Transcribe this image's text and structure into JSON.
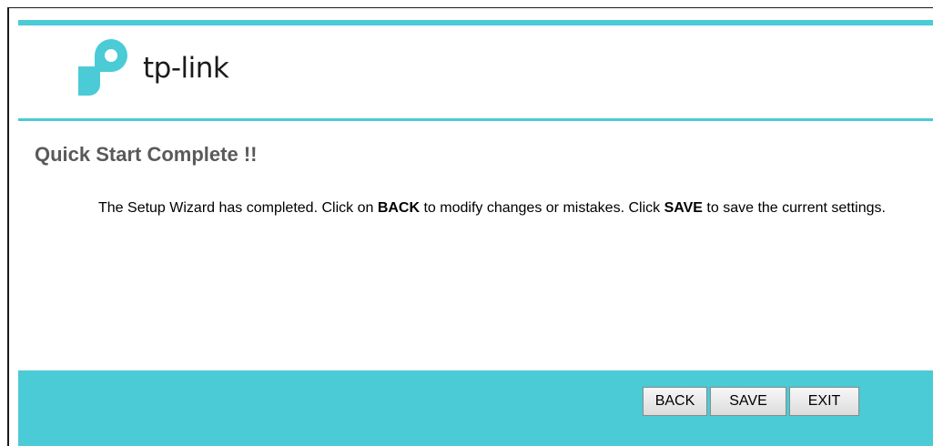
{
  "brand": {
    "logo_text": "tp-link",
    "logo_icon": "tp-link-logo-icon",
    "accent_color": "#4acbd6"
  },
  "page": {
    "title": "Quick Start Complete !!"
  },
  "message": {
    "part1": "The Setup Wizard has completed. Click on ",
    "back_word": "BACK",
    "part2": " to modify changes or mistakes. Click ",
    "save_word": "SAVE",
    "part3": " to save the current settings."
  },
  "footer": {
    "back_label": "BACK",
    "save_label": "SAVE",
    "exit_label": "EXIT"
  }
}
